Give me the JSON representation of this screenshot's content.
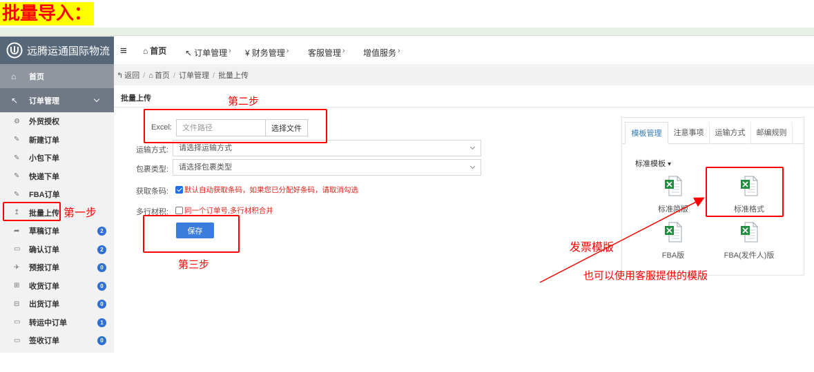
{
  "heading": "批量导入：",
  "app": {
    "logo_text": "远腾运通国际物流",
    "logo_icon": "company-logo-icon"
  },
  "topnav": {
    "menu_icon": "menu-icon",
    "items": [
      {
        "label": "首页",
        "icon": "home-icon"
      },
      {
        "label": "订单管理",
        "icon": "hand-pointer-icon"
      },
      {
        "label": "财务管理",
        "icon": "yen-icon"
      },
      {
        "label": "客服管理"
      },
      {
        "label": "增值服务"
      }
    ]
  },
  "sidebar": {
    "home": "首页",
    "section": "订单管理",
    "items": [
      {
        "label": "外贸授权",
        "icon": "gear-icon"
      },
      {
        "label": "新建订单",
        "icon": "edit-icon"
      },
      {
        "label": "小包下单",
        "icon": "edit-icon"
      },
      {
        "label": "快递下单",
        "icon": "edit-icon"
      },
      {
        "label": "FBA订单",
        "icon": "edit-icon"
      },
      {
        "label": "批量上传",
        "icon": "upload-icon"
      },
      {
        "label": "草稿订单",
        "icon": "share-icon",
        "badge": 2
      },
      {
        "label": "确认订单",
        "icon": "file-icon",
        "badge": 2
      },
      {
        "label": "预报订单",
        "icon": "plane-icon",
        "badge": 0
      },
      {
        "label": "收货订单",
        "icon": "inbox-icon",
        "badge": 0
      },
      {
        "label": "出货订单",
        "icon": "outbox-icon",
        "badge": 0
      },
      {
        "label": "转运中订单",
        "icon": "file-icon",
        "badge": 1
      },
      {
        "label": "签收订单",
        "icon": "file-icon",
        "badge": 0
      }
    ]
  },
  "breadcrumb": {
    "back": "返回",
    "separator": "/",
    "items": [
      "首页",
      "订单管理",
      "批量上传"
    ]
  },
  "panel": {
    "title": "批量上传"
  },
  "form": {
    "excel_label": "Excel:",
    "excel_placeholder": "文件路径",
    "choose_file": "选择文件",
    "shipping_label": "运输方式:",
    "shipping_value": "请选择运输方式",
    "package_label": "包裹类型:",
    "package_value": "请选择包裹类型",
    "barcode_label": "获取条码:",
    "barcode_checked": true,
    "barcode_text": "默认自动获取条码，如果您已分配好条码，请取消勾选",
    "volume_label": "多行材积:",
    "volume_checked": false,
    "volume_text": "同一个订单号,多行材积合并",
    "save": "保存"
  },
  "templates": {
    "tabs": [
      "模板管理",
      "注意事项",
      "运输方式",
      "邮编规则"
    ],
    "active_tab": "模板管理",
    "dropdown": "标准模板",
    "files": [
      {
        "label": "标准简版",
        "icon": "excel-file-icon"
      },
      {
        "label": "标准格式",
        "icon": "excel-file-icon"
      },
      {
        "label": "FBA版",
        "icon": "excel-file-icon"
      },
      {
        "label": "FBA(发件人)版",
        "icon": "excel-file-icon"
      }
    ]
  },
  "annotations": {
    "step1": "第一步",
    "step2": "第二步",
    "step3": "第三步",
    "invoice_template": "发票模版",
    "service_template": "也可以使用客服提供的模版"
  },
  "colors": {
    "annotation": "#ff0000",
    "heading_highlight": "#ffff00",
    "accent": "#337ab7",
    "primary_button": "#3b7ddd",
    "badge": "#2f6fd8",
    "sidebar_header": "#56677a",
    "notice_text": "#e2231a"
  }
}
